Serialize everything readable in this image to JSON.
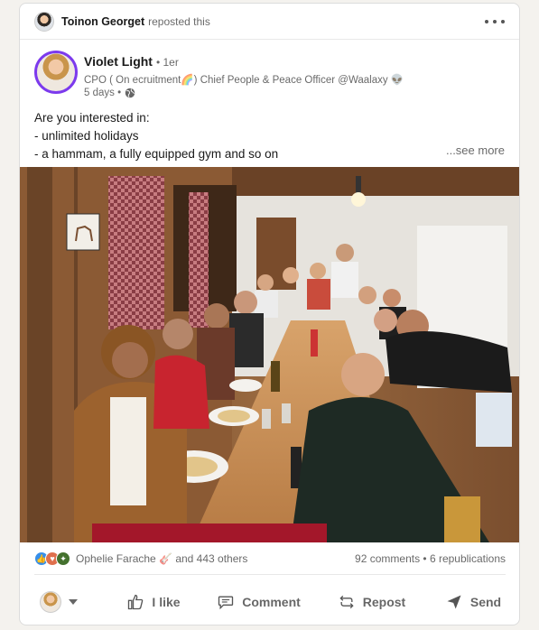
{
  "repost": {
    "user_name": "Toinon Georget",
    "action_text": "reposted this"
  },
  "post": {
    "author": {
      "name": "Violet Light",
      "degree": "• 1er",
      "headline": "CPO ( On ecruitment🌈) Chief People & Peace Officer @Waalaxy 👽",
      "time": "5 days •"
    },
    "text_lines": [
      "Are you interested in:",
      "- unlimited holidays",
      "- a hammam, a fully equipped gym and so on"
    ],
    "see_more_label": "...see more"
  },
  "social": {
    "reactions_text": "Ophelie Farache 🎸 and 443 others",
    "comments_text": "92 comments • 6 republications"
  },
  "actions": {
    "like_label": "I like",
    "comment_label": "Comment",
    "repost_label": "Repost",
    "send_label": "Send"
  },
  "colors": {
    "avatar_ring": "#7c3aed",
    "like_blue": "#378fe9",
    "love_red": "#df704d",
    "support_teal": "#44712e"
  },
  "icons": {
    "more": "more-options-icon",
    "globe": "globe-icon",
    "like": "thumbs-up-icon",
    "comment": "comment-icon",
    "repost": "repost-icon",
    "send": "send-icon"
  }
}
